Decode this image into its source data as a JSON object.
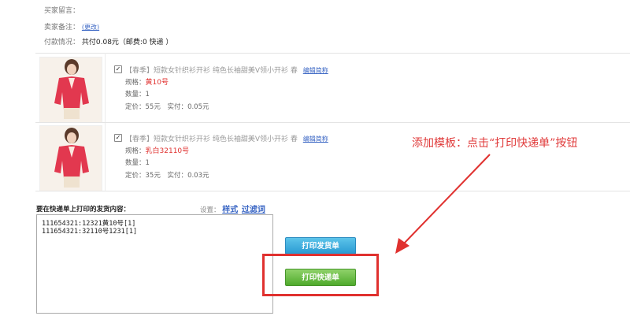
{
  "buyer_message": {
    "label": "买家留言：",
    "value": ""
  },
  "seller_note": {
    "label": "卖家备注：",
    "change_link": "(更改)"
  },
  "payment": {
    "label": "付款情况：",
    "value": "共付0.08元（邮费:0 快递 ）"
  },
  "items": [
    {
      "title": "【春季】短款女针织衫开衫 纯色长袖甜美V领小开衫 春",
      "edit_link": "编辑简称",
      "spec_label": "规格：",
      "spec_value": "黄10号",
      "qty_label": "数量：",
      "qty_value": "1",
      "price_label": "定价：",
      "price_value": "55元",
      "paid_label": "实付：",
      "paid_value": "0.05元",
      "checked": true
    },
    {
      "title": "【春季】短款女针织衫开衫 纯色长袖甜美V领小开衫 春",
      "edit_link": "编辑简称",
      "spec_label": "规格：",
      "spec_value": "乳白32110号",
      "qty_label": "数量：",
      "qty_value": "1",
      "price_label": "定价：",
      "price_value": "35元",
      "paid_label": "实付：",
      "paid_value": "0.03元",
      "checked": true
    }
  ],
  "print_section": {
    "heading": "要在快递单上打印的发货内容：",
    "settings_label": "设置：",
    "style_link": "样式",
    "filter_link": "过滤词",
    "content": "111654321:12321黄10号[1]\n111654321:32110号1231[1]"
  },
  "buttons": {
    "print_invoice": "打印发货单",
    "print_express": "打印快递单"
  },
  "annotation": {
    "text": "添加模板：点击“打印快递单”按钮",
    "color": "#e03a3a"
  },
  "colors": {
    "blue_button": "#2a9ad2",
    "green_button": "#4faa2c",
    "highlight_red": "#e0312f"
  }
}
